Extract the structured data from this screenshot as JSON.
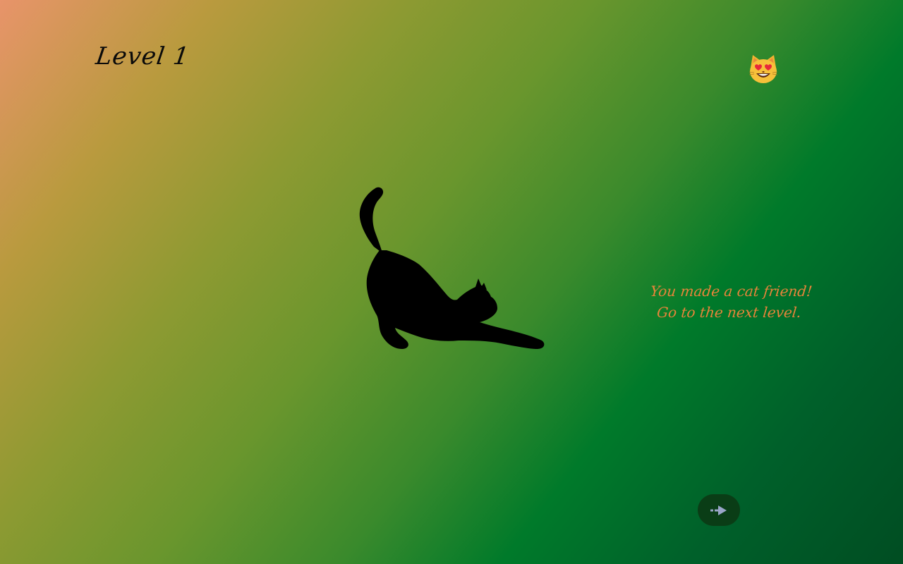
{
  "game": {
    "level_label": "Level 1",
    "mood_icon": "smiling-cat-heart-eyes-icon",
    "message_line1": "You made a cat friend!",
    "message_line2": "Go to the next level.",
    "next_icon": "arrow-right-icon"
  },
  "colors": {
    "background_start": "#e8946a",
    "background_mid": "#6a962d",
    "background_end": "#004d22",
    "message": "#e8843a",
    "button_bg": "#0a3d16",
    "button_icon": "#9aa6c8"
  }
}
